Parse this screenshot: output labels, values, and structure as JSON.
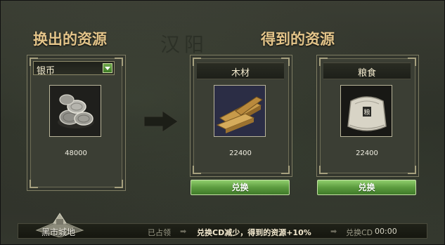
{
  "watermark": "汉阳",
  "left": {
    "title": "换出的资源",
    "select_value": "银币",
    "amount": "48000",
    "icon": "silver-coins-icon"
  },
  "right": {
    "title": "得到的资源",
    "cards": [
      {
        "name": "木材",
        "amount": "22400",
        "button": "兑换",
        "icon": "wood-planks-icon"
      },
      {
        "name": "粮食",
        "amount": "22400",
        "button": "兑换",
        "icon": "grain-sack-icon"
      }
    ]
  },
  "status": {
    "city": "黑市城地",
    "occupied": "已占领",
    "bonus": "兑换CD减少，得到的资源+10%",
    "cd_label": "兑换CD",
    "cd_time": "00:00"
  },
  "colors": {
    "title": "#e4c58a",
    "button": "#5c9c3f",
    "bonus_text": "#f3e9cf",
    "dim_text": "#9c9b88"
  }
}
